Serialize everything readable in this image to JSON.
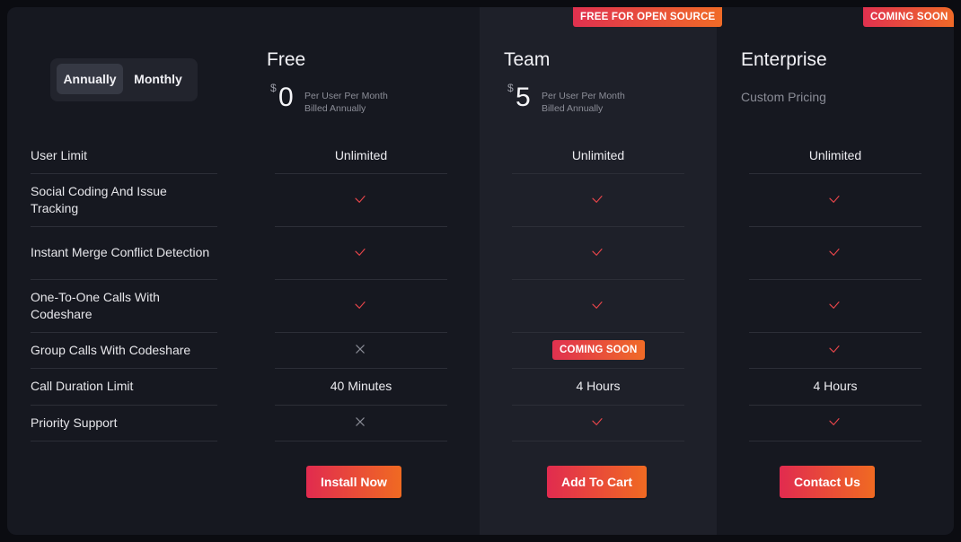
{
  "billing_toggle": {
    "annually": "Annually",
    "monthly": "Monthly",
    "selected": "Annually"
  },
  "plans": [
    {
      "name": "Free",
      "currency": "$",
      "price": "0",
      "price_desc_1": "Per User Per Month",
      "price_desc_2": "Billed Annually",
      "button": "Install Now"
    },
    {
      "name": "Team",
      "currency": "$",
      "price": "5",
      "price_desc_1": "Per User Per Month",
      "price_desc_2": "Billed Annually",
      "button": "Add To Cart",
      "badge": "FREE FOR OPEN SOURCE"
    },
    {
      "name": "Enterprise",
      "custom_pricing": "Custom Pricing",
      "button": "Contact Us",
      "badge": "COMING SOON"
    }
  ],
  "features": [
    {
      "label": "User Limit",
      "values": [
        "Unlimited",
        "Unlimited",
        "Unlimited"
      ]
    },
    {
      "label": "Social Coding And Issue Tracking",
      "values": [
        "check",
        "check",
        "check"
      ]
    },
    {
      "label": "Instant Merge Conflict Detection",
      "values": [
        "check",
        "check",
        "check"
      ]
    },
    {
      "label": "One-To-One Calls With Codeshare",
      "values": [
        "check",
        "check",
        "check"
      ]
    },
    {
      "label": "Group Calls With Codeshare",
      "values": [
        "cross",
        "badge",
        "check"
      ],
      "team_badge": "COMING SOON"
    },
    {
      "label": "Call Duration Limit",
      "values": [
        "40 Minutes",
        "4 Hours",
        "4 Hours"
      ]
    },
    {
      "label": "Priority Support",
      "values": [
        "cross",
        "check",
        "check"
      ]
    }
  ],
  "icons": {
    "check": "check-icon",
    "cross": "cross-icon"
  },
  "colors": {
    "accent_start": "#e0314f",
    "accent_end": "#f06b27",
    "check": "#e8454a",
    "cross": "#8a8c96"
  }
}
